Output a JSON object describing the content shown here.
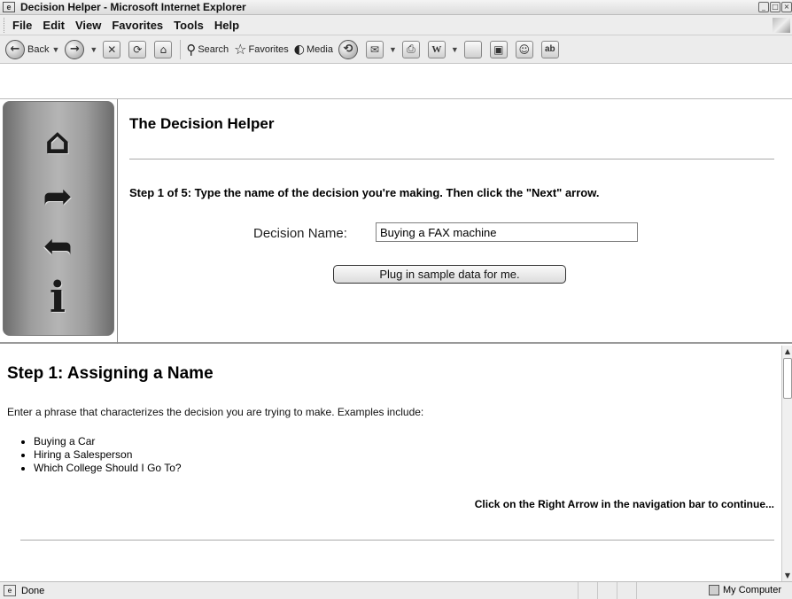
{
  "window": {
    "title": "Decision Helper - Microsoft Internet Explorer"
  },
  "menu": [
    "File",
    "Edit",
    "View",
    "Favorites",
    "Tools",
    "Help"
  ],
  "toolbar": {
    "back_label": "Back",
    "search_label": "Search",
    "favorites_label": "Favorites",
    "media_label": "Media"
  },
  "nav": {
    "buttons": [
      "home-icon",
      "right-arrow-icon",
      "left-arrow-icon",
      "info-icon"
    ]
  },
  "main": {
    "title": "The Decision Helper",
    "step_instruction": "Step 1 of 5: Type the name of the decision you're making. Then click the \"Next\" arrow.",
    "decision_name_label": "Decision Name:",
    "decision_name_value": "Buying a FAX machine",
    "sample_button_label": "Plug in sample data for me."
  },
  "help": {
    "heading": "Step 1: Assigning a Name",
    "intro": "Enter a phrase that characterizes the decision you are trying to make. Examples include:",
    "examples": [
      "Buying a Car",
      "Hiring a Salesperson",
      "Which College Should I Go To?"
    ],
    "continue_text": "Click on the Right Arrow in the navigation bar to continue..."
  },
  "status": {
    "text": "Done",
    "zone": "My Computer"
  }
}
